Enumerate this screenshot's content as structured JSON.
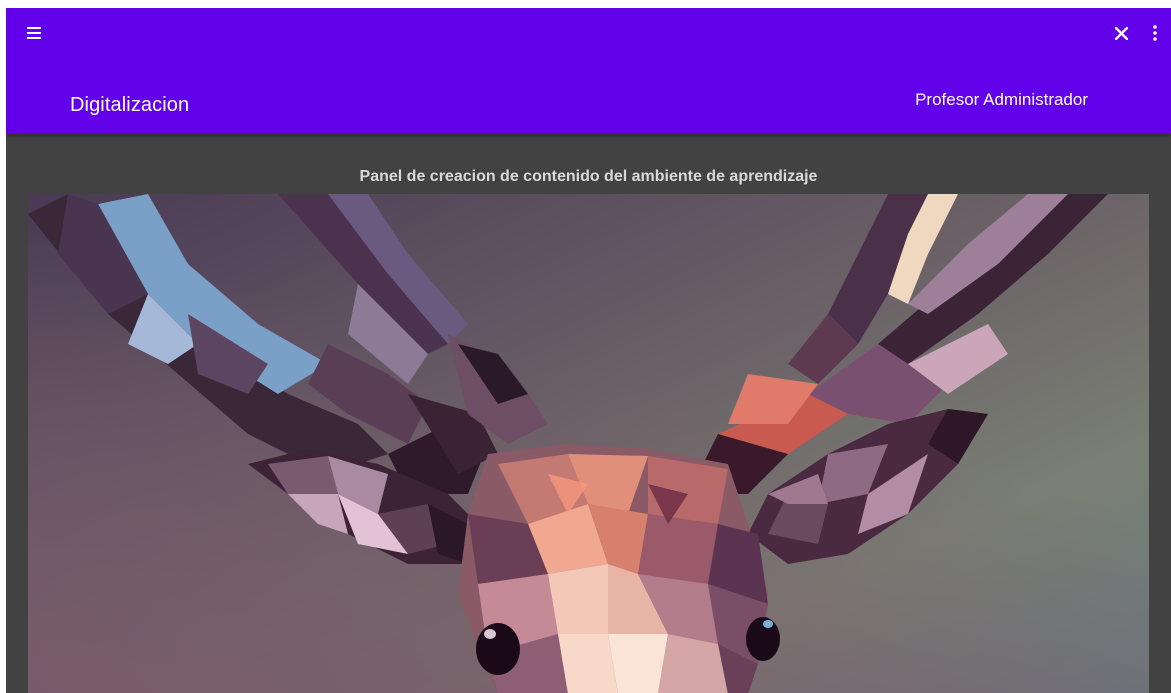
{
  "appbar": {
    "title": "Digitalizacion",
    "user_label": "Profesor Administrador",
    "menu_icon": "hamburger-menu-icon",
    "close_icon": "close-icon",
    "more_icon": "more-vert-icon",
    "color": "#6200ea"
  },
  "main": {
    "heading": "Panel de creacion de contenido del ambiente de aprendizaje",
    "background": "#424242",
    "hero_image": "low-poly-deer-illustration"
  }
}
